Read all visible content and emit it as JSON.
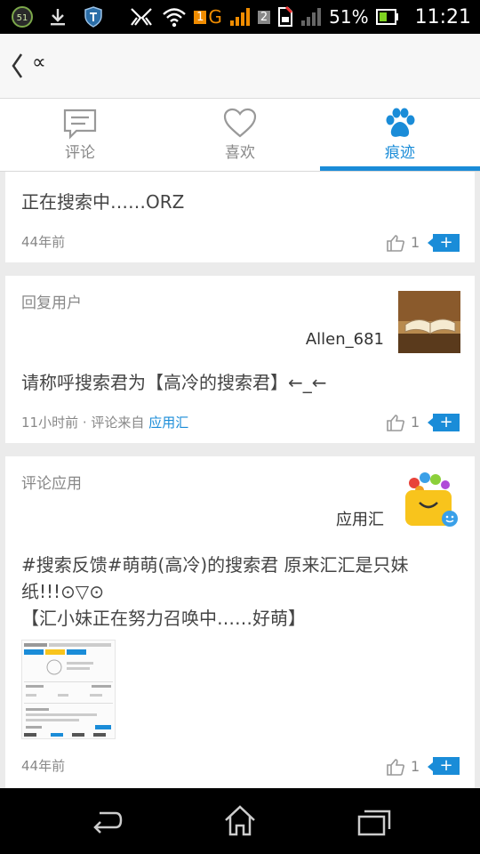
{
  "status_bar": {
    "notif_badge": "51",
    "sim1": "1",
    "network_type": "G",
    "sim2": "2",
    "battery_percent": "51%",
    "time": "11:21"
  },
  "app_bar": {
    "title": "∝"
  },
  "tabs": [
    {
      "label": "评论",
      "icon": "comment-icon"
    },
    {
      "label": "喜欢",
      "icon": "heart-icon"
    },
    {
      "label": "痕迹",
      "icon": "paw-icon",
      "active": true
    }
  ],
  "feed": [
    {
      "content": "正在搜索中……ORZ",
      "time": "44年前",
      "likes": "1"
    },
    {
      "label": "回复用户",
      "username": "Allen_681",
      "content": "请称呼搜索君为【高冷的搜索君】←_←",
      "time": "11小时前 · 评论来自",
      "source": "应用汇",
      "likes": "1"
    },
    {
      "label": "评论应用",
      "app_name": "应用汇",
      "content_line1": "#搜索反馈#萌萌(高冷)的搜索君 原来汇汇是只妹",
      "content_line2": "纸!!!⊙▽⊙",
      "content_line3": "【汇小妹正在努力召唤中……好萌】",
      "time": "44年前",
      "likes": "1"
    }
  ],
  "colors": {
    "accent": "#1a8cd8",
    "status_bar_bg": "#000000",
    "nav_bar_bg": "#000000"
  }
}
